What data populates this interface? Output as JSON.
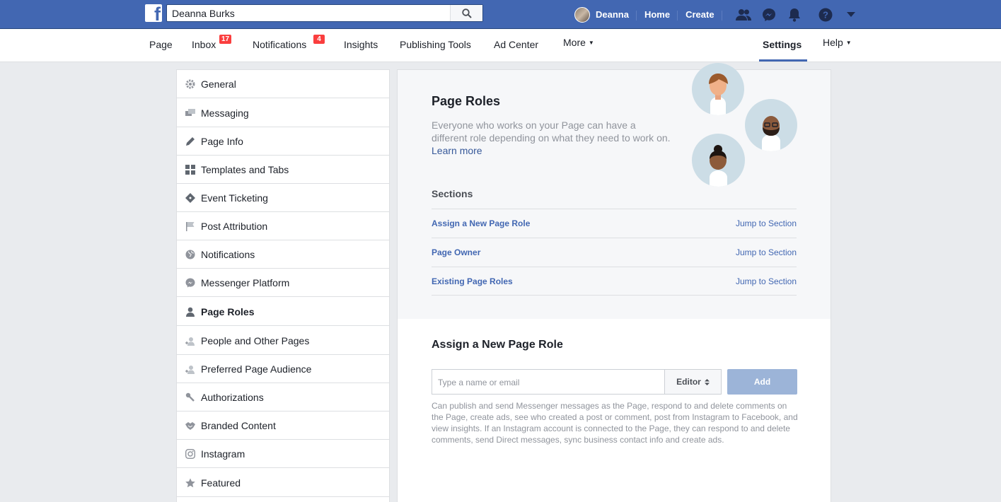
{
  "topbar": {
    "search_value": "Deanna Burks",
    "user_name": "Deanna",
    "home_label": "Home",
    "create_label": "Create",
    "icons": [
      "friends-icon",
      "messenger-icon",
      "notifications-bell-icon",
      "help-icon",
      "account-menu-icon"
    ],
    "brand_color": "#4267b2"
  },
  "pagenav": {
    "page": "Page",
    "inbox": "Inbox",
    "inbox_badge": "17",
    "notifications": "Notifications",
    "notifications_badge": "4",
    "insights": "Insights",
    "publishing_tools": "Publishing Tools",
    "ad_center": "Ad Center",
    "more": "More",
    "settings": "Settings",
    "help": "Help"
  },
  "sidebar": {
    "items": [
      {
        "label": "General",
        "icon": "gear-icon"
      },
      {
        "label": "Messaging",
        "icon": "messaging-icon"
      },
      {
        "label": "Page Info",
        "icon": "pencil-icon"
      },
      {
        "label": "Templates and Tabs",
        "icon": "grid-icon"
      },
      {
        "label": "Event Ticketing",
        "icon": "ticket-icon"
      },
      {
        "label": "Post Attribution",
        "icon": "flag-icon"
      },
      {
        "label": "Notifications",
        "icon": "globe-icon"
      },
      {
        "label": "Messenger Platform",
        "icon": "messenger-icon"
      },
      {
        "label": "Page Roles",
        "icon": "person-icon"
      },
      {
        "label": "People and Other Pages",
        "icon": "add-person-icon"
      },
      {
        "label": "Preferred Page Audience",
        "icon": "add-person-icon"
      },
      {
        "label": "Authorizations",
        "icon": "wrench-icon"
      },
      {
        "label": "Branded Content",
        "icon": "handshake-icon"
      },
      {
        "label": "Instagram",
        "icon": "instagram-icon"
      },
      {
        "label": "Featured",
        "icon": "star-icon"
      }
    ],
    "selected": "Page Roles"
  },
  "main": {
    "title": "Page Roles",
    "description": "Everyone who works on your Page can have a different role depending on what they need to work on.",
    "learn_more": "Learn more",
    "sections_heading": "Sections",
    "sections": [
      {
        "name": "Assign a New Page Role",
        "jump": "Jump to Section"
      },
      {
        "name": "Page Owner",
        "jump": "Jump to Section"
      },
      {
        "name": "Existing Page Roles",
        "jump": "Jump to Section"
      }
    ],
    "assign_heading": "Assign a New Page Role",
    "name_placeholder": "Type a name or email",
    "role_value": "Editor",
    "add_label": "Add",
    "role_description": "Can publish and send Messenger messages as the Page, respond to and delete comments on the Page, create ads, see who created a post or comment, post from Instagram to Facebook, and view insights. If an Instagram account is connected to the Page, they can respond to and delete comments, send Direct messages, sync business contact info and create ads."
  }
}
